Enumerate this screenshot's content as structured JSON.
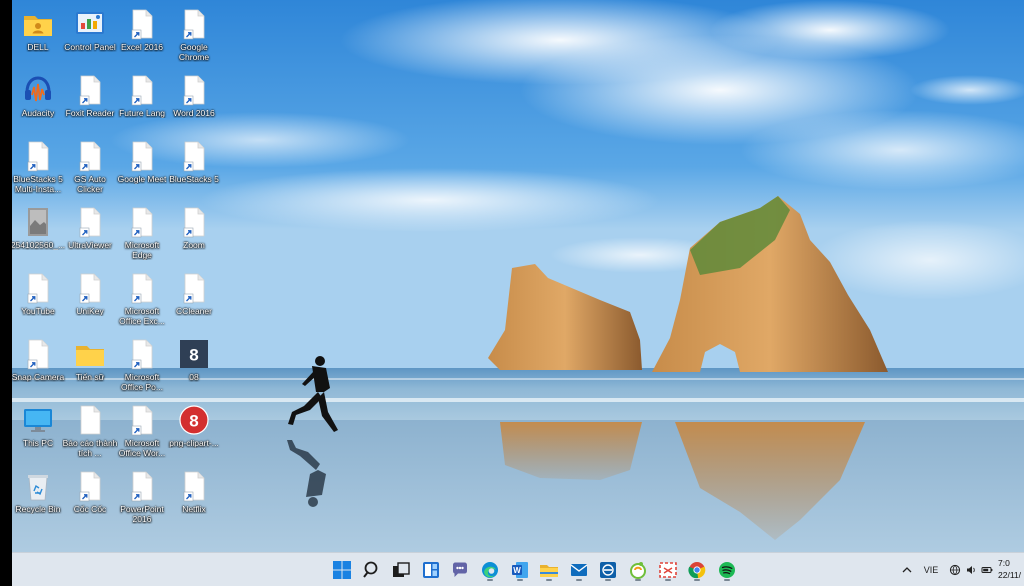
{
  "desktop": {
    "icons": [
      {
        "label": "DELL",
        "icon": "folder-user-icon"
      },
      {
        "label": "Control Panel",
        "icon": "control-panel-icon"
      },
      {
        "label": "Excel 2016",
        "icon": "file-shortcut-icon"
      },
      {
        "label": "Google Chrome",
        "icon": "file-shortcut-icon"
      },
      {
        "label": "Audacity",
        "icon": "audacity-icon"
      },
      {
        "label": "Foxit Reader",
        "icon": "file-shortcut-icon"
      },
      {
        "label": "Future Lang",
        "icon": "file-shortcut-icon"
      },
      {
        "label": "Word 2016",
        "icon": "file-shortcut-icon"
      },
      {
        "label": "BlueStacks 5 Multi-Insta...",
        "icon": "file-shortcut-icon"
      },
      {
        "label": "GS Auto Clicker",
        "icon": "file-shortcut-icon"
      },
      {
        "label": "Google Meet",
        "icon": "file-shortcut-icon"
      },
      {
        "label": "BlueStacks 5",
        "icon": "file-shortcut-icon"
      },
      {
        "label": "254102560_...",
        "icon": "image-file-icon"
      },
      {
        "label": "UltraViewer",
        "icon": "file-shortcut-icon"
      },
      {
        "label": "Microsoft Edge",
        "icon": "file-shortcut-icon"
      },
      {
        "label": "Zoom",
        "icon": "file-shortcut-icon"
      },
      {
        "label": "YouTube",
        "icon": "file-shortcut-icon"
      },
      {
        "label": "UniKey",
        "icon": "file-shortcut-icon"
      },
      {
        "label": "Microsoft Office Exc...",
        "icon": "file-shortcut-icon"
      },
      {
        "label": "CCleaner",
        "icon": "file-shortcut-icon"
      },
      {
        "label": "Snap Camera",
        "icon": "file-shortcut-icon"
      },
      {
        "label": "Tiến sữ",
        "icon": "folder-icon"
      },
      {
        "label": "Microsoft Office Po...",
        "icon": "file-shortcut-icon"
      },
      {
        "label": "08",
        "icon": "number-8-dark-icon"
      },
      {
        "label": "This PC",
        "icon": "monitor-icon"
      },
      {
        "label": "Báo cáo thành tích ...",
        "icon": "file-icon"
      },
      {
        "label": "Microsoft Office Wor...",
        "icon": "file-shortcut-icon"
      },
      {
        "label": "png-clipart-...",
        "icon": "number-8-red-icon"
      },
      {
        "label": "Recycle Bin",
        "icon": "recycle-bin-icon"
      },
      {
        "label": "Cốc Cốc",
        "icon": "file-shortcut-icon"
      },
      {
        "label": "PowerPoint 2016",
        "icon": "file-shortcut-icon"
      },
      {
        "label": "Netflix",
        "icon": "file-shortcut-icon"
      }
    ]
  },
  "taskbar": {
    "apps": [
      {
        "name": "Start",
        "icon": "windows-start-icon"
      },
      {
        "name": "Search",
        "icon": "search-icon"
      },
      {
        "name": "Task View",
        "icon": "task-view-icon"
      },
      {
        "name": "Widgets",
        "icon": "widgets-icon"
      },
      {
        "name": "Chat",
        "icon": "teams-chat-icon"
      },
      {
        "name": "Microsoft Edge",
        "icon": "edge-icon"
      },
      {
        "name": "Microsoft Word",
        "icon": "word-icon"
      },
      {
        "name": "File Explorer",
        "icon": "file-explorer-icon"
      },
      {
        "name": "Mail",
        "icon": "mail-icon"
      },
      {
        "name": "App",
        "icon": "blue-square-app-icon"
      },
      {
        "name": "Cốc Cốc",
        "icon": "coccoc-icon"
      },
      {
        "name": "Snipping",
        "icon": "snipping-icon"
      },
      {
        "name": "Google Chrome",
        "icon": "chrome-icon"
      },
      {
        "name": "Spotify",
        "icon": "spotify-icon"
      }
    ],
    "tray": {
      "chevron": "chevron-up-icon",
      "language": "VIE",
      "time": "7:0",
      "date": "22/11/"
    }
  }
}
